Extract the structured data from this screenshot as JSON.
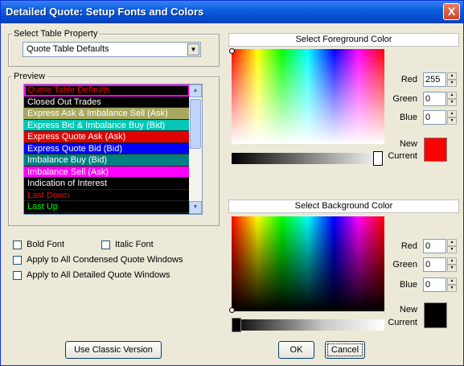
{
  "window": {
    "title": "Detailed Quote: Setup Fonts and Colors",
    "close_label": "X"
  },
  "table_property": {
    "legend": "Select Table Property",
    "selected": "Quote Table Defaults"
  },
  "preview": {
    "legend": "Preview",
    "items": [
      {
        "label": "Quote Table Defaults",
        "bg": "#000000",
        "fg": "#ff0000",
        "selected": true
      },
      {
        "label": "Closed Out Trades",
        "bg": "#000000",
        "fg": "#ffffff"
      },
      {
        "label": "Express Ask & Imbalance Sell (Ask)",
        "bg": "#a8a860",
        "fg": "#ffffff"
      },
      {
        "label": "Express Bid & Imbalance Buy (Bid)",
        "bg": "#00c8b4",
        "fg": "#ffffff"
      },
      {
        "label": "Express Quote Ask (Ask)",
        "bg": "#e00000",
        "fg": "#ffffff"
      },
      {
        "label": "Express Quote Bid (Bid)",
        "bg": "#0000ff",
        "fg": "#ffffff"
      },
      {
        "label": "Imbalance Buy (Bid)",
        "bg": "#008080",
        "fg": "#ffffff"
      },
      {
        "label": "Imbalance Sell (Ask)",
        "bg": "#ff00ff",
        "fg": "#ffffff"
      },
      {
        "label": "Indication of Interest",
        "bg": "#000000",
        "fg": "#ffffff"
      },
      {
        "label": "Last Down",
        "bg": "#000000",
        "fg": "#ff0000"
      },
      {
        "label": "Last Up",
        "bg": "#000000",
        "fg": "#00ff00"
      }
    ]
  },
  "options": {
    "bold_font": "Bold Font",
    "italic_font": "Italic Font",
    "apply_condensed": "Apply to All Condensed Quote Windows",
    "apply_detailed": "Apply to All Detailed Quote Windows"
  },
  "foreground": {
    "heading": "Select Foreground Color",
    "red_label": "Red",
    "green_label": "Green",
    "blue_label": "Blue",
    "red": "255",
    "green": "0",
    "blue": "0",
    "new_label": "New",
    "current_label": "Current",
    "swatch_color": "#ff0000"
  },
  "background": {
    "heading": "Select Background Color",
    "red_label": "Red",
    "green_label": "Green",
    "blue_label": "Blue",
    "red": "0",
    "green": "0",
    "blue": "0",
    "new_label": "New",
    "current_label": "Current",
    "swatch_color": "#000000"
  },
  "buttons": {
    "classic": "Use Classic Version",
    "ok": "OK",
    "cancel": "Cancel"
  }
}
